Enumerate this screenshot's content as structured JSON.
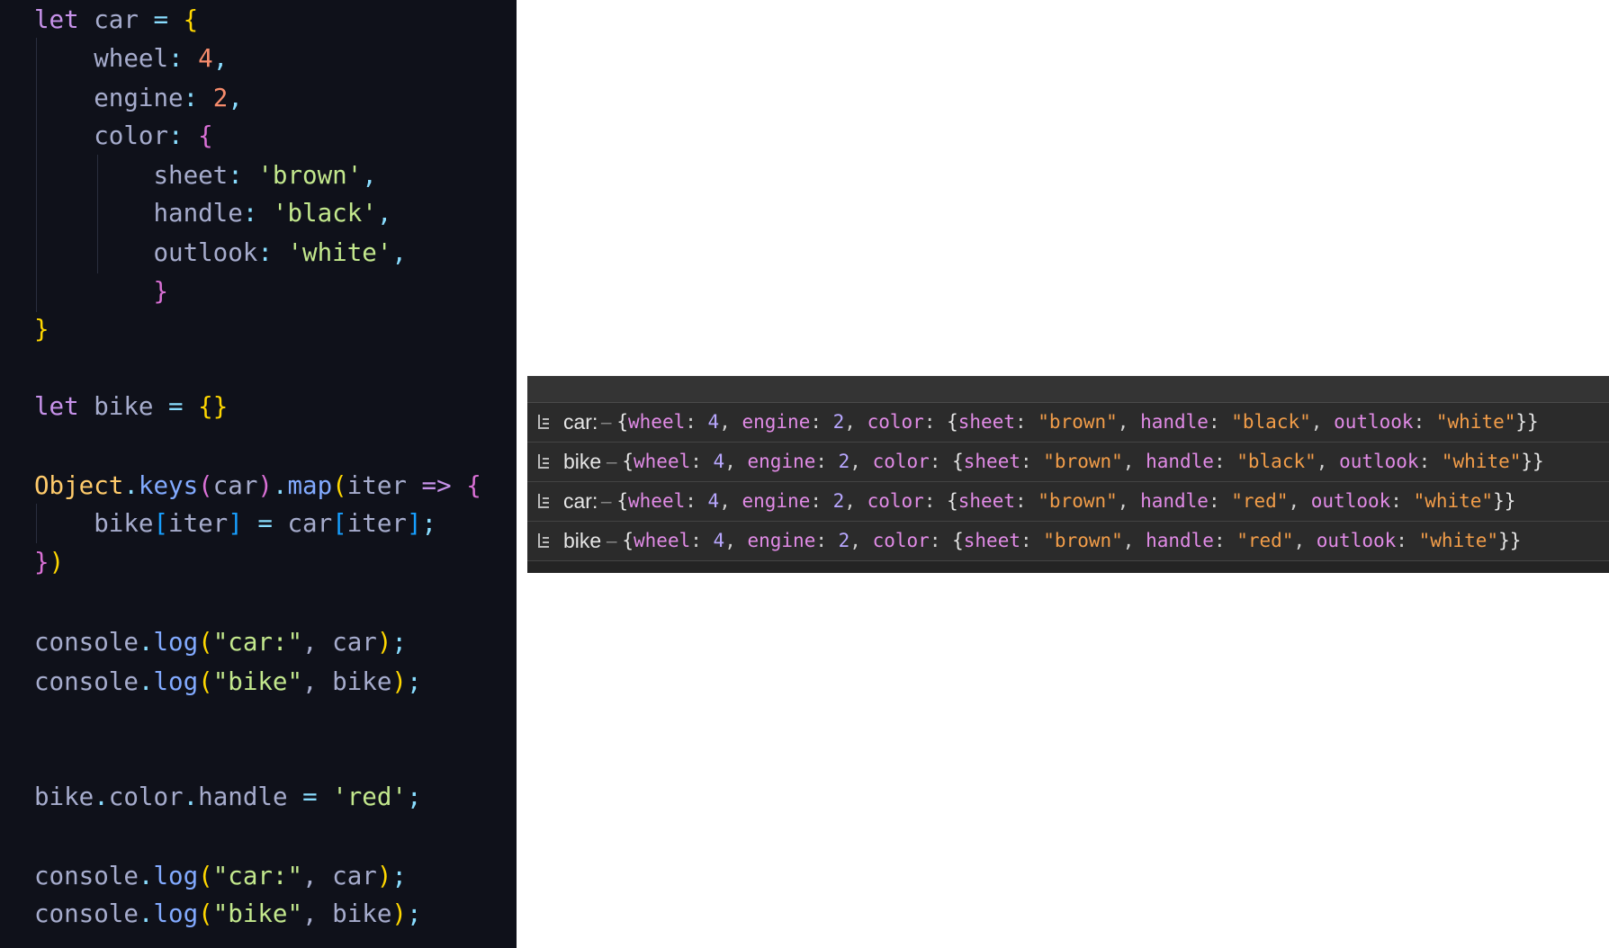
{
  "editor": {
    "lines": [
      {
        "tokens": [
          [
            "let",
            "kw"
          ],
          [
            " car ",
            "id"
          ],
          [
            "=",
            "op"
          ],
          [
            " ",
            "id"
          ],
          [
            "{",
            "p1"
          ]
        ]
      },
      {
        "tokens": [
          [
            "    wheel",
            "prop"
          ],
          [
            ": ",
            "op"
          ],
          [
            "4",
            "num"
          ],
          [
            ",",
            "op"
          ]
        ]
      },
      {
        "tokens": [
          [
            "    engine",
            "prop"
          ],
          [
            ": ",
            "op"
          ],
          [
            "2",
            "num"
          ],
          [
            ",",
            "op"
          ]
        ]
      },
      {
        "tokens": [
          [
            "    color",
            "prop"
          ],
          [
            ": ",
            "op"
          ],
          [
            "{",
            "p2"
          ]
        ]
      },
      {
        "tokens": [
          [
            "        sheet",
            "prop"
          ],
          [
            ": ",
            "op"
          ],
          [
            "'brown'",
            "str"
          ],
          [
            ",",
            "op"
          ]
        ]
      },
      {
        "tokens": [
          [
            "        handle",
            "prop"
          ],
          [
            ": ",
            "op"
          ],
          [
            "'black'",
            "str"
          ],
          [
            ",",
            "op"
          ]
        ]
      },
      {
        "tokens": [
          [
            "        outlook",
            "prop"
          ],
          [
            ": ",
            "op"
          ],
          [
            "'white'",
            "str"
          ],
          [
            ",",
            "op"
          ]
        ]
      },
      {
        "tokens": [
          [
            "        }",
            "p2"
          ]
        ]
      },
      {
        "tokens": [
          [
            "}",
            "p1"
          ]
        ]
      },
      {
        "tokens": [
          [
            "let",
            "kw"
          ],
          [
            " bike ",
            "id"
          ],
          [
            "=",
            "op"
          ],
          [
            " ",
            "id"
          ],
          [
            "{}",
            "p1"
          ]
        ]
      },
      {
        "tokens": [
          [
            "Object",
            "cls"
          ],
          [
            ".",
            "op"
          ],
          [
            "keys",
            "fn"
          ],
          [
            "(",
            "p2"
          ],
          [
            "car",
            "id"
          ],
          [
            ")",
            "p2"
          ],
          [
            ".",
            "op"
          ],
          [
            "map",
            "fn"
          ],
          [
            "(",
            "p1"
          ],
          [
            "iter ",
            "id"
          ],
          [
            "=>",
            "kw"
          ],
          [
            " ",
            "id"
          ],
          [
            "{",
            "p2"
          ]
        ]
      },
      {
        "tokens": [
          [
            "    bike",
            "id"
          ],
          [
            "[",
            "p3"
          ],
          [
            "iter",
            "id"
          ],
          [
            "]",
            "p3"
          ],
          [
            " ",
            "id"
          ],
          [
            "=",
            "op"
          ],
          [
            " car",
            "id"
          ],
          [
            "[",
            "p3"
          ],
          [
            "iter",
            "id"
          ],
          [
            "]",
            "p3"
          ],
          [
            ";",
            "op"
          ]
        ]
      },
      {
        "tokens": [
          [
            "}",
            "p2"
          ],
          [
            ")",
            "p1"
          ]
        ]
      },
      {
        "tokens": [
          [
            "console",
            "id"
          ],
          [
            ".",
            "op"
          ],
          [
            "log",
            "fn"
          ],
          [
            "(",
            "p1"
          ],
          [
            "\"car:\"",
            "str"
          ],
          [
            ", car",
            "id"
          ],
          [
            ")",
            "p1"
          ],
          [
            ";",
            "op"
          ]
        ]
      },
      {
        "tokens": [
          [
            "console",
            "id"
          ],
          [
            ".",
            "op"
          ],
          [
            "log",
            "fn"
          ],
          [
            "(",
            "p1"
          ],
          [
            "\"bike\"",
            "str"
          ],
          [
            ", bike",
            "id"
          ],
          [
            ")",
            "p1"
          ],
          [
            ";",
            "op"
          ]
        ]
      },
      {
        "tokens": [
          [
            "bike",
            "id"
          ],
          [
            ".",
            "op"
          ],
          [
            "color",
            "id"
          ],
          [
            ".",
            "op"
          ],
          [
            "handle ",
            "id"
          ],
          [
            "=",
            "op"
          ],
          [
            " ",
            "id"
          ],
          [
            "'red'",
            "str"
          ],
          [
            ";",
            "op"
          ]
        ]
      },
      {
        "tokens": [
          [
            "console",
            "id"
          ],
          [
            ".",
            "op"
          ],
          [
            "log",
            "fn"
          ],
          [
            "(",
            "p1"
          ],
          [
            "\"car:\"",
            "str"
          ],
          [
            ", car",
            "id"
          ],
          [
            ")",
            "p1"
          ],
          [
            ";",
            "op"
          ]
        ]
      },
      {
        "tokens": [
          [
            "console",
            "id"
          ],
          [
            ".",
            "op"
          ],
          [
            "log",
            "fn"
          ],
          [
            "(",
            "p1"
          ],
          [
            "\"bike\"",
            "str"
          ],
          [
            ", bike",
            "id"
          ],
          [
            ")",
            "p1"
          ],
          [
            ";",
            "op"
          ]
        ]
      }
    ]
  },
  "console": {
    "rows": [
      {
        "label": "car:",
        "sep": "–",
        "obj": {
          "wheel": "4",
          "engine": "2",
          "sheet": "\"brown\"",
          "handle": "\"black\"",
          "outlook": "\"white\""
        }
      },
      {
        "label": "bike",
        "sep": "–",
        "obj": {
          "wheel": "4",
          "engine": "2",
          "sheet": "\"brown\"",
          "handle": "\"black\"",
          "outlook": "\"white\""
        }
      },
      {
        "label": "car:",
        "sep": "–",
        "obj": {
          "wheel": "4",
          "engine": "2",
          "sheet": "\"brown\"",
          "handle": "\"red\"",
          "outlook": "\"white\""
        }
      },
      {
        "label": "bike",
        "sep": "–",
        "obj": {
          "wheel": "4",
          "engine": "2",
          "sheet": "\"brown\"",
          "handle": "\"red\"",
          "outlook": "\"white\""
        }
      }
    ],
    "icon": "log-entry-icon"
  },
  "theme": {
    "editor_bg": "#0f111a",
    "console_bg": "#2b2b2b"
  }
}
